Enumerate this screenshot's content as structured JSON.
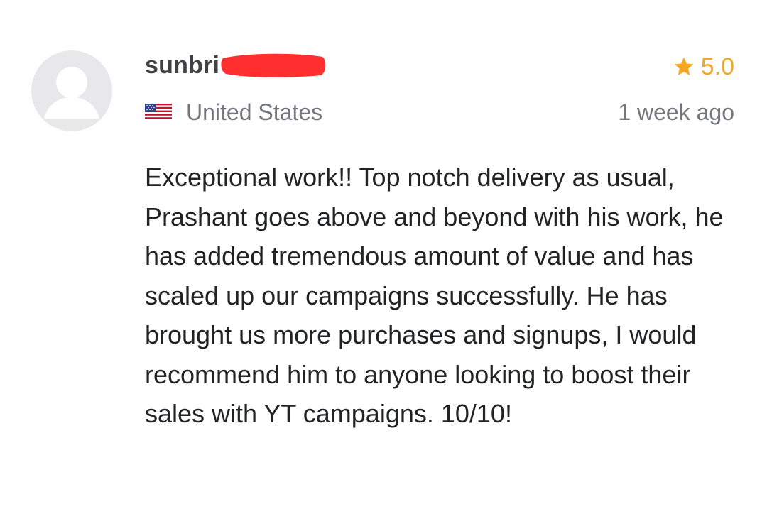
{
  "review": {
    "username": "sunbri",
    "rating": "5.0",
    "country": "United States",
    "flag_icon": "us-flag-icon",
    "star_icon": "star-icon",
    "time_ago": "1 week ago",
    "text": "Exceptional work!! Top notch delivery as usual, Prashant goes above and beyond with his work, he has added tremendous amount of value and has scaled up our campaigns successfully. He has brought us more purchases and signups, I would recommend him to anyone looking to boost their sales with YT campaigns. 10/10!"
  },
  "colors": {
    "star": "#f5a623",
    "username": "#404145",
    "meta_text": "#74767e",
    "body_text": "#222325",
    "avatar_bg": "#e8e8ea",
    "redaction": "#ff2f2f"
  }
}
